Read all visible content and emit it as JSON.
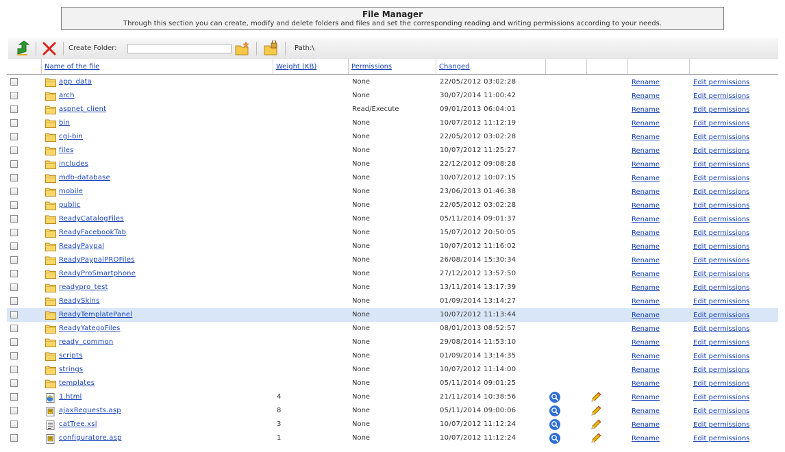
{
  "header": {
    "title": "File Manager",
    "description": "Through this section you can create, modify and delete folders and files and set the corresponding reading and writing permissions according to your needs."
  },
  "toolbar": {
    "create_folder_label": "Create Folder:",
    "create_folder_value": "",
    "path_label": "Path:\\"
  },
  "columns": {
    "name": "Name of the file",
    "weight": "Weight (KB)",
    "permissions": "Permissions",
    "changed": "Changed"
  },
  "actions": {
    "rename": "Rename",
    "edit_permissions": "Edit permissions"
  },
  "rows": [
    {
      "name": "app_data",
      "type": "folder",
      "weight": "",
      "perm": "None",
      "changed": "22/05/2012 03:02:28"
    },
    {
      "name": "arch",
      "type": "folder",
      "weight": "",
      "perm": "None",
      "changed": "30/07/2014 11:00:42"
    },
    {
      "name": "aspnet_client",
      "type": "folder",
      "weight": "",
      "perm": "Read/Execute",
      "changed": "09/01/2013 06:04:01"
    },
    {
      "name": "bin",
      "type": "folder",
      "weight": "",
      "perm": "None",
      "changed": "10/07/2012 11:12:19"
    },
    {
      "name": "cgi-bin",
      "type": "folder",
      "weight": "",
      "perm": "None",
      "changed": "22/05/2012 03:02:28"
    },
    {
      "name": "files",
      "type": "folder",
      "weight": "",
      "perm": "None",
      "changed": "10/07/2012 11:25:27"
    },
    {
      "name": "includes",
      "type": "folder",
      "weight": "",
      "perm": "None",
      "changed": "22/12/2012 09:08:28"
    },
    {
      "name": "mdb-database",
      "type": "folder",
      "weight": "",
      "perm": "None",
      "changed": "10/07/2012 10:07:15"
    },
    {
      "name": "mobile",
      "type": "folder",
      "weight": "",
      "perm": "None",
      "changed": "23/06/2013 01:46:38"
    },
    {
      "name": "public",
      "type": "folder",
      "weight": "",
      "perm": "None",
      "changed": "22/05/2012 03:02:28"
    },
    {
      "name": "ReadyCatalogFiles",
      "type": "folder",
      "weight": "",
      "perm": "None",
      "changed": "05/11/2014 09:01:37"
    },
    {
      "name": "ReadyFacebookTab",
      "type": "folder",
      "weight": "",
      "perm": "None",
      "changed": "15/07/2012 20:50:05"
    },
    {
      "name": "ReadyPaypal",
      "type": "folder",
      "weight": "",
      "perm": "None",
      "changed": "10/07/2012 11:16:02"
    },
    {
      "name": "ReadyPaypalPROFiles",
      "type": "folder",
      "weight": "",
      "perm": "None",
      "changed": "26/08/2014 15:30:34"
    },
    {
      "name": "ReadyProSmartphone",
      "type": "folder",
      "weight": "",
      "perm": "None",
      "changed": "27/12/2012 13:57:50"
    },
    {
      "name": "readypro_test",
      "type": "folder",
      "weight": "",
      "perm": "None",
      "changed": "13/11/2014 13:17:39"
    },
    {
      "name": "ReadySkins",
      "type": "folder",
      "weight": "",
      "perm": "None",
      "changed": "01/09/2014 13:14:27"
    },
    {
      "name": "ReadyTemplatePanel",
      "type": "folder",
      "weight": "",
      "perm": "None",
      "changed": "10/07/2012 11:13:44",
      "selected": true
    },
    {
      "name": "ReadyYategoFiles",
      "type": "folder",
      "weight": "",
      "perm": "None",
      "changed": "08/01/2013 08:52:57"
    },
    {
      "name": "ready_common",
      "type": "folder",
      "weight": "",
      "perm": "None",
      "changed": "29/08/2014 11:53:10"
    },
    {
      "name": "scripts",
      "type": "folder",
      "weight": "",
      "perm": "None",
      "changed": "01/09/2014 13:14:35"
    },
    {
      "name": "strings",
      "type": "folder",
      "weight": "",
      "perm": "None",
      "changed": "10/07/2012 11:14:00"
    },
    {
      "name": "templates",
      "type": "folder",
      "weight": "",
      "perm": "None",
      "changed": "05/11/2014 09:01:25"
    },
    {
      "name": "1.html",
      "type": "html",
      "weight": "4",
      "perm": "None",
      "changed": "21/11/2014 10:38:56"
    },
    {
      "name": "ajaxRequests.asp",
      "type": "asp",
      "weight": "8",
      "perm": "None",
      "changed": "05/11/2014 09:00:06"
    },
    {
      "name": "catTree.xsl",
      "type": "xsl",
      "weight": "3",
      "perm": "None",
      "changed": "10/07/2012 11:12:24"
    },
    {
      "name": "configuratore.asp",
      "type": "asp",
      "weight": "1",
      "perm": "None",
      "changed": "10/07/2012 11:12:24"
    }
  ]
}
